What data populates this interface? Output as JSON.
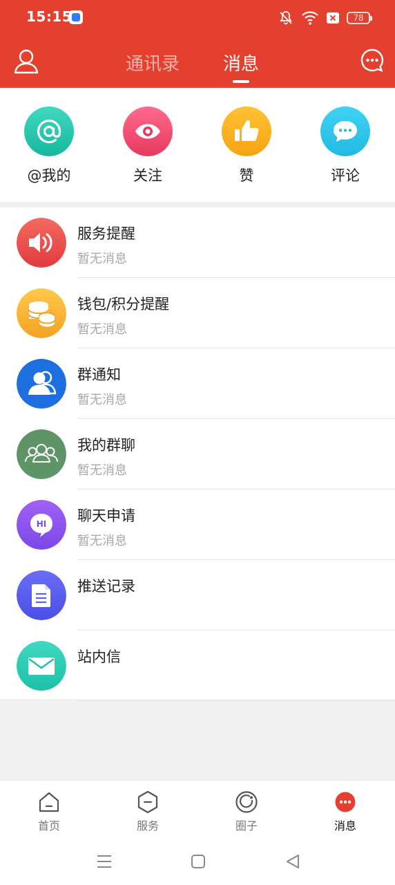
{
  "status_bar": {
    "time": "15:15",
    "battery": "78"
  },
  "header": {
    "tabs": [
      {
        "label": "通讯录"
      },
      {
        "label": "消息"
      }
    ]
  },
  "quick_actions": [
    {
      "label": "@我的",
      "icon": "at-icon"
    },
    {
      "label": "关注",
      "icon": "eye-icon"
    },
    {
      "label": "赞",
      "icon": "thumbs-up-icon"
    },
    {
      "label": "评论",
      "icon": "comment-icon"
    }
  ],
  "messages": [
    {
      "title": "服务提醒",
      "subtitle": "暂无消息",
      "icon": "speaker-icon",
      "color": "#e94b4b"
    },
    {
      "title": "钱包/积分提醒",
      "subtitle": "暂无消息",
      "icon": "coins-icon",
      "color": "#f9b93b"
    },
    {
      "title": "群通知",
      "subtitle": "暂无消息",
      "icon": "group-icon",
      "color": "#1d6fe0"
    },
    {
      "title": "我的群聊",
      "subtitle": "暂无消息",
      "icon": "group-chat-icon",
      "color": "#5f9466"
    },
    {
      "title": "聊天申请",
      "subtitle": "暂无消息",
      "icon": "hi-bubble-icon",
      "color": "#8a55ef"
    },
    {
      "title": "推送记录",
      "subtitle": "",
      "icon": "document-icon",
      "color": "#5a5ff0"
    },
    {
      "title": "站内信",
      "subtitle": "",
      "icon": "mail-icon",
      "color": "#2cc9b3"
    }
  ],
  "bottom_nav": [
    {
      "label": "首页",
      "icon": "home-icon"
    },
    {
      "label": "服务",
      "icon": "service-icon"
    },
    {
      "label": "圈子",
      "icon": "circle-icon"
    },
    {
      "label": "消息",
      "icon": "message-icon"
    }
  ]
}
